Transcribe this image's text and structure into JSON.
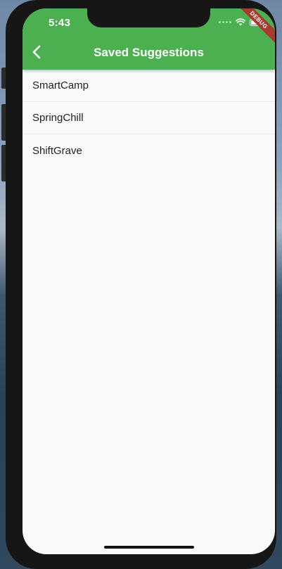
{
  "status_bar": {
    "time": "5:43"
  },
  "debug_banner": {
    "label": "DEBUG"
  },
  "app_bar": {
    "title": "Saved Suggestions",
    "back_icon": "chevron-left-icon",
    "background_color": "#4caf50"
  },
  "saved_list": {
    "items": [
      {
        "label": "SmartCamp"
      },
      {
        "label": "SpringChill"
      },
      {
        "label": "ShiftGrave"
      }
    ]
  }
}
